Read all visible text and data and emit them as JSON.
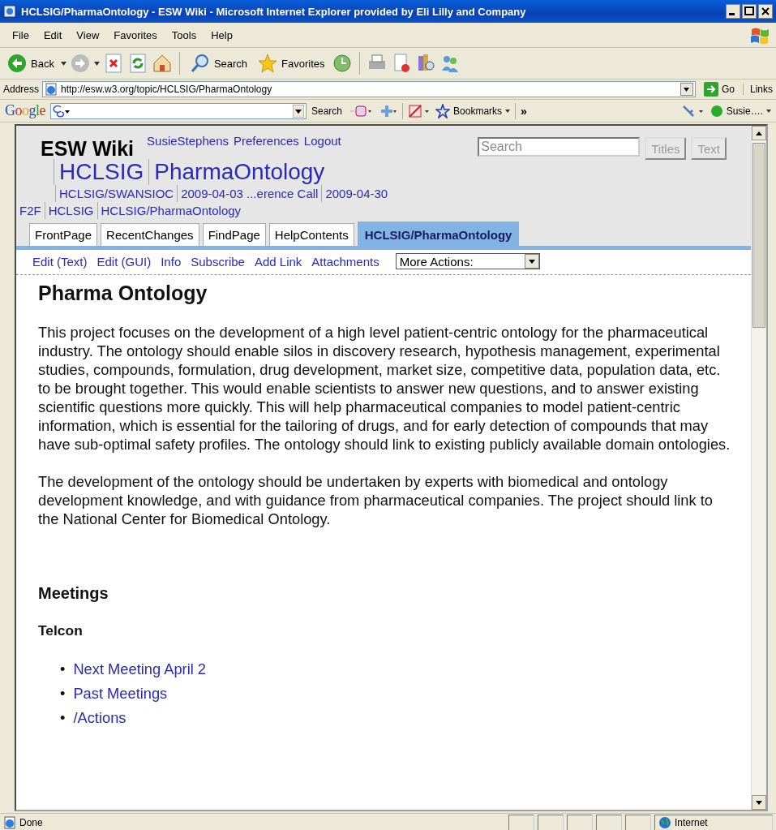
{
  "window": {
    "title": "HCLSIG/PharmaOntology - ESW Wiki - Microsoft Internet Explorer provided by Eli Lilly and Company"
  },
  "menu": [
    "File",
    "Edit",
    "View",
    "Favorites",
    "Tools",
    "Help"
  ],
  "toolbar": [
    {
      "kind": "back",
      "label": "Back"
    },
    {
      "kind": "forward"
    },
    {
      "kind": "stop"
    },
    {
      "kind": "refresh"
    },
    {
      "kind": "home"
    },
    {
      "kind": "search",
      "label": "Search"
    },
    {
      "kind": "favorites",
      "label": "Favorites"
    },
    {
      "kind": "history"
    },
    {
      "kind": "print"
    },
    {
      "kind": "edit"
    },
    {
      "kind": "research"
    },
    {
      "kind": "messenger"
    }
  ],
  "address": {
    "label": "Address",
    "url": "http://esw.w3.org/topic/HCLSIG/PharmaOntology",
    "go": "Go",
    "links": "Links"
  },
  "google_bar": {
    "logo": "Google",
    "search": "Search",
    "bookmarks": "Bookmarks",
    "more": "»",
    "user": "Susie…."
  },
  "wiki": {
    "logo": "ESW Wiki",
    "user_links": [
      "SusieStephens",
      "Preferences",
      "Logout"
    ],
    "search": {
      "placeholder": "Search"
    },
    "buttons": [
      "Titles",
      "Text"
    ],
    "page_title": [
      "HCLSIG",
      "PharmaOntology"
    ],
    "trail": [
      [
        "HCLSIG/SWANSIOC",
        "2009-04-03 ...erence Call",
        "2009-04-30"
      ],
      [
        "F2F",
        "HCLSIG",
        "HCLSIG/PharmaOntology"
      ]
    ],
    "tabs": [
      {
        "label": "FrontPage",
        "selected": false
      },
      {
        "label": "RecentChanges",
        "selected": false
      },
      {
        "label": "FindPage",
        "selected": false
      },
      {
        "label": "HelpContents",
        "selected": false
      },
      {
        "label": "HCLSIG/PharmaOntology",
        "selected": true
      }
    ],
    "actions": [
      "Edit (Text)",
      "Edit (GUI)",
      "Info",
      "Subscribe",
      "Add Link",
      "Attachments"
    ],
    "more_actions": "More Actions:"
  },
  "content": {
    "heading": "Pharma Ontology",
    "paragraphs": [
      "This project focuses on the development of a high level patient-centric ontology for the pharmaceutical industry. The ontology should enable silos in discovery research, hypothesis management, experimental studies, compounds, formulation, drug development, market size, competitive data, population data, etc. to be brought together. This would enable scientists to answer new questions, and to answer existing scientific questions more quickly. This will help pharmaceutical companies to model patient-centric information, which is essential for the tailoring of drugs, and for early detection of compounds that may have sub-optimal safety profiles. The ontology should link to existing publicly available domain ontologies.",
      "The development of the ontology should be undertaken by experts with biomedical and ontology development knowledge, and with guidance from pharmaceutical companies. The project should link to the National Center for Biomedical Ontology."
    ],
    "section": "Meetings",
    "subsection": "Telcon",
    "links": [
      {
        "bullet": "•",
        "label": "Next Meeting April 2"
      },
      {
        "bullet": "•",
        "label": "Past Meetings"
      },
      {
        "bullet": "•",
        "label": "/Actions"
      }
    ]
  },
  "status_bar": {
    "status": "Done",
    "zone": "Internet"
  }
}
